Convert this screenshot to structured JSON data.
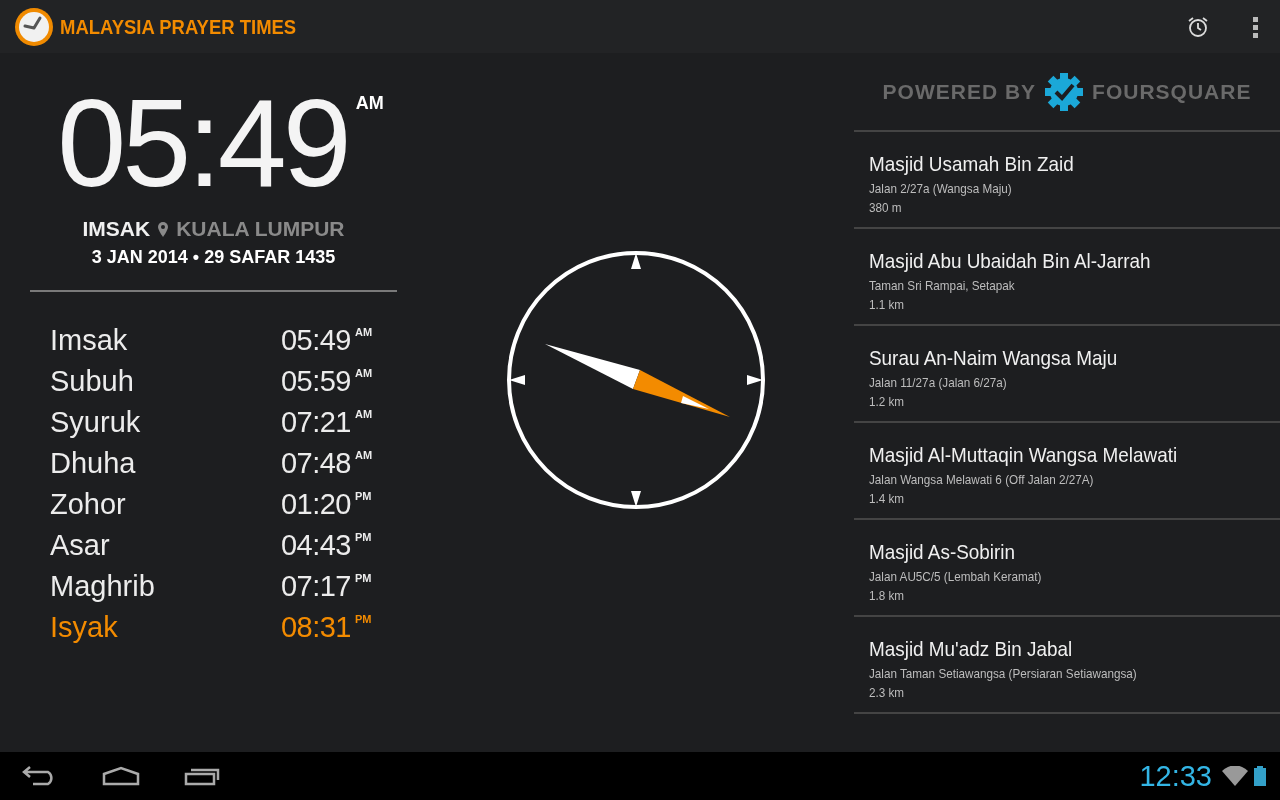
{
  "app_bar": {
    "title": "MALAYSIA PRAYER TIMES"
  },
  "clock": {
    "time": "05:49",
    "period": "AM",
    "prayer": "IMSAK",
    "location": "KUALA LUMPUR",
    "date": "3 JAN 2014 • 29 SAFAR 1435"
  },
  "prayers": [
    {
      "name": "Imsak",
      "time": "05:49",
      "period": "AM",
      "current": false
    },
    {
      "name": "Subuh",
      "time": "05:59",
      "period": "AM",
      "current": false
    },
    {
      "name": "Syuruk",
      "time": "07:21",
      "period": "AM",
      "current": false
    },
    {
      "name": "Dhuha",
      "time": "07:48",
      "period": "AM",
      "current": false
    },
    {
      "name": "Zohor",
      "time": "01:20",
      "period": "PM",
      "current": false
    },
    {
      "name": "Asar",
      "time": "04:43",
      "period": "PM",
      "current": false
    },
    {
      "name": "Maghrib",
      "time": "07:17",
      "period": "PM",
      "current": false
    },
    {
      "name": "Isyak",
      "time": "08:31",
      "period": "PM",
      "current": true
    }
  ],
  "powered_by": {
    "prefix": "POWERED BY",
    "brand": "FOURSQUARE"
  },
  "mosques": [
    {
      "name": "Masjid Usamah Bin Zaid",
      "address": "Jalan 2/27a (Wangsa Maju)",
      "distance": "380 m"
    },
    {
      "name": "Masjid Abu Ubaidah Bin Al-Jarrah",
      "address": "Taman Sri Rampai, Setapak",
      "distance": "1.1 km"
    },
    {
      "name": "Surau An-Naim Wangsa Maju",
      "address": "Jalan 11/27a (Jalan 6/27a)",
      "distance": "1.2 km"
    },
    {
      "name": "Masjid Al-Muttaqin Wangsa Melawati",
      "address": "Jalan Wangsa Melawati 6 (Off Jalan 2/27A)",
      "distance": "1.4 km"
    },
    {
      "name": "Masjid As-Sobirin",
      "address": "Jalan AU5C/5 (Lembah Keramat)",
      "distance": "1.8 km"
    },
    {
      "name": "Masjid Mu'adz Bin Jabal",
      "address": "Jalan Taman Setiawangsa (Persiaran Setiawangsa)",
      "distance": "2.3 km"
    }
  ],
  "status_bar": {
    "time": "12:33"
  }
}
